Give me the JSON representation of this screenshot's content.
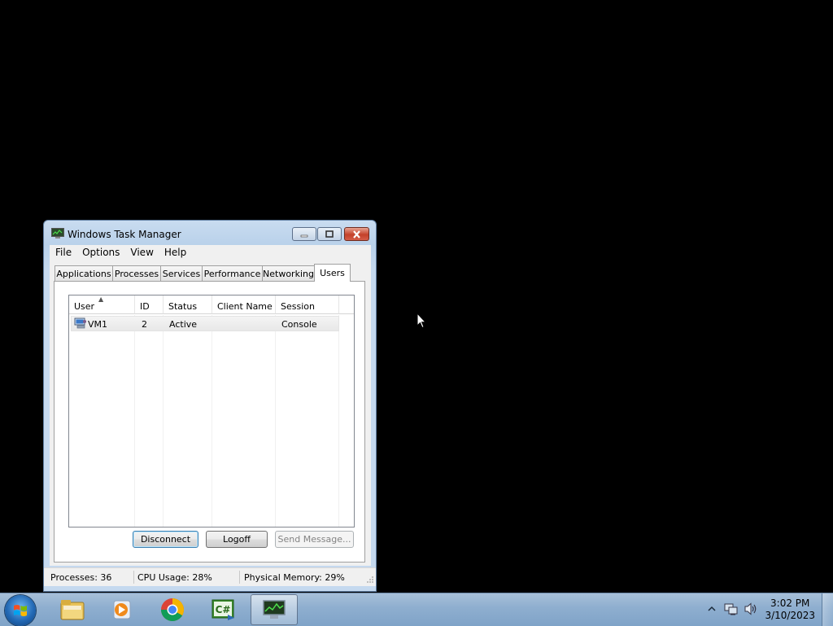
{
  "window": {
    "title": "Windows Task Manager",
    "menu": [
      "File",
      "Options",
      "View",
      "Help"
    ],
    "tabs": [
      {
        "label": "Applications",
        "active": false
      },
      {
        "label": "Processes",
        "active": false
      },
      {
        "label": "Services",
        "active": false
      },
      {
        "label": "Performance",
        "active": false
      },
      {
        "label": "Networking",
        "active": false
      },
      {
        "label": "Users",
        "active": true
      }
    ],
    "users_table": {
      "columns": [
        "User",
        "ID",
        "Status",
        "Client Name",
        "Session"
      ],
      "sorted_column": "User",
      "rows": [
        {
          "user": "VM1",
          "id": "2",
          "status": "Active",
          "client_name": "",
          "session": "Console"
        }
      ]
    },
    "buttons": {
      "disconnect": "Disconnect",
      "logoff": "Logoff",
      "send_message": "Send Message..."
    },
    "status_bar": {
      "processes": "Processes: 36",
      "cpu_usage": "CPU Usage: 28%",
      "physical_memory": "Physical Memory: 29%"
    }
  },
  "taskbar": {
    "apps": [
      "windows-explorer-icon",
      "media-player-icon",
      "chrome-icon",
      "csharp-ide-icon",
      "task-manager-icon"
    ],
    "active_app": "task-manager-icon",
    "clock": {
      "time": "3:02 PM",
      "date": "3/10/2023"
    }
  },
  "colors": {
    "desktop": "#000000",
    "window_frame": "#b9d1ea",
    "close_button": "#c4412a",
    "taskbar": "#8eaecf"
  }
}
